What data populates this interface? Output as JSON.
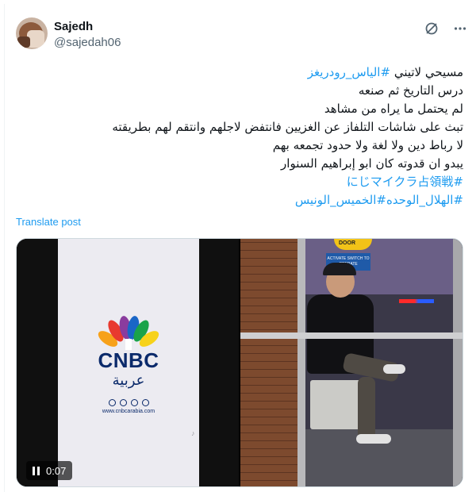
{
  "author": {
    "display_name": "Sajedh",
    "handle": "@sajedah06"
  },
  "header_icons": {
    "grok": "grok-icon",
    "more": "more-icon"
  },
  "tweet": {
    "line1_text": "مسيحي لاتيني ",
    "line1_tag": "#الياس_رودريغز",
    "line2": "درس التاريخ ثم صنعه",
    "line3": "لم يحتمل ما يراه من مشاهد",
    "line4": "تبث على شاشات التلفاز عن الغزيين فانتفض لاجلهم وانتقم لهم بطريقته",
    "line5": "لا رباط دين ولا لغة ولا حدود تجمعه بهم",
    "line6": "يبدو ان قدوته كان ابو إبراهيم السنوار",
    "tag_line1": "#にじマイクラ占領戦",
    "tag_line2_a": "#الهلال_الوحده",
    "tag_line2_b": "#الخميس_الونيس"
  },
  "translate_label": "Translate post",
  "media": {
    "video_logo_text": "CNBC",
    "video_logo_arabic": "عربية",
    "video_url": "www.cnbcarabia.com",
    "video_time": "0:07",
    "pause_icon": "pause-icon",
    "photo_door_sign": "DOOR",
    "photo_blue_sign": "ACTIVATE SWITCH TO OPERATE"
  },
  "colors": {
    "link": "#1d9bf0",
    "secondary_text": "#536471"
  }
}
